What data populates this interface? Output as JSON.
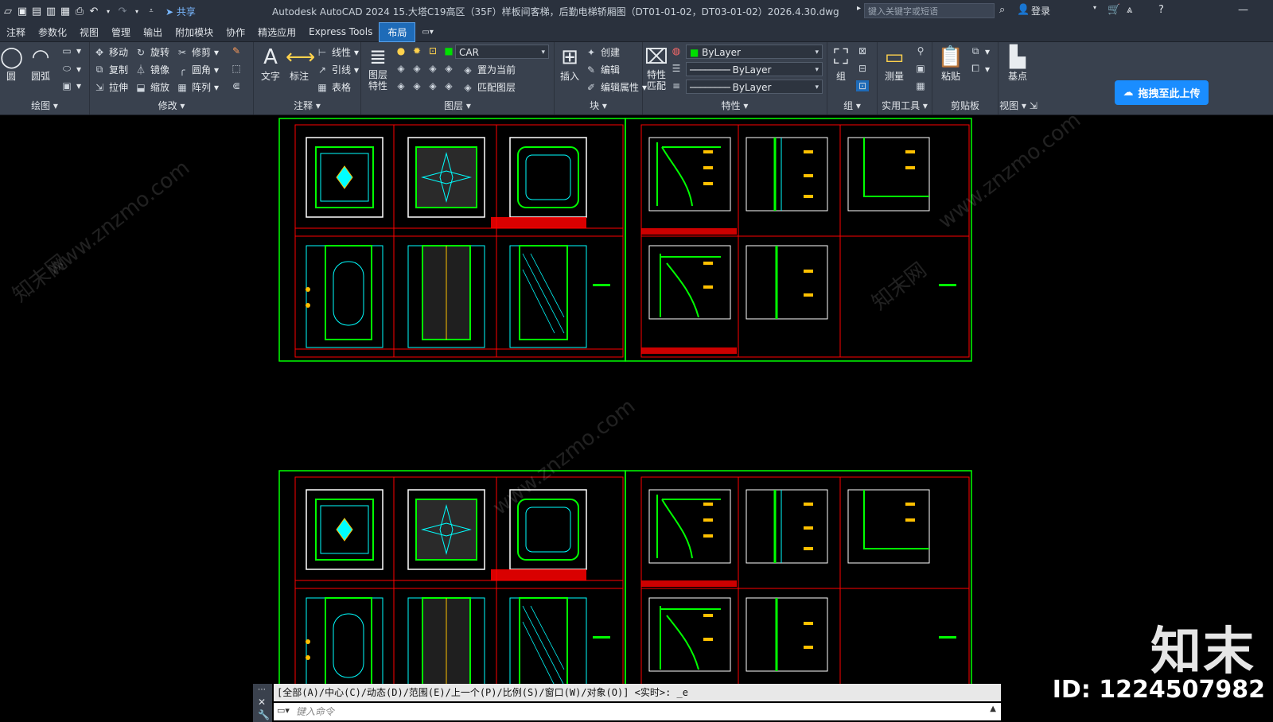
{
  "title_bar": {
    "share_label": "共享",
    "title": "Autodesk AutoCAD 2024    15.大塔C19高区（35F）样板间客梯，后勤电梯轿厢图（DT01-01-02，DT03-01-02）2026.4.30.dwg",
    "search_placeholder": "键入关键字或短语",
    "login_label": "登录"
  },
  "menu": [
    "注释",
    "参数化",
    "视图",
    "管理",
    "输出",
    "附加模块",
    "协作",
    "精选应用",
    "Express Tools",
    "布局"
  ],
  "ribbon": {
    "draw": {
      "circle": "圆",
      "arc": "圆弧",
      "label": "绘图"
    },
    "modify": {
      "move": "移动",
      "rotate": "旋转",
      "trim": "修剪",
      "copy": "复制",
      "mirror": "镜像",
      "fillet": "圆角",
      "stretch": "拉伸",
      "scale": "缩放",
      "array": "阵列",
      "label": "修改"
    },
    "annotation": {
      "text": "文字",
      "dimension": "标注",
      "linear": "线性",
      "leader": "引线",
      "table": "表格",
      "label": "注释"
    },
    "layers": {
      "layer_props": "图层特性",
      "layer_name": "CAR",
      "set_current": "置为当前",
      "match_layer": "匹配图层",
      "label": "图层"
    },
    "block": {
      "insert": "插入",
      "create": "创建",
      "edit": "编辑",
      "edit_attr": "编辑属性",
      "label": "块"
    },
    "properties": {
      "match": "特性匹配",
      "color": "ByLayer",
      "linetype": "ByLayer",
      "lineweight": "ByLayer",
      "label": "特性"
    },
    "group": {
      "group": "组",
      "label": "组"
    },
    "utilities": {
      "measure": "测量",
      "label": "实用工具"
    },
    "clipboard": {
      "paste": "粘贴",
      "label": "剪贴板"
    },
    "view": {
      "base": "基点",
      "label": "视图"
    }
  },
  "upload_button": "拖拽至此上传",
  "command": {
    "history": "[全部(A)/中心(C)/动态(D)/范围(E)/上一个(P)/比例(S)/窗口(W)/对象(O)] <实时>: _e",
    "placeholder": "键入命令"
  },
  "watermark": {
    "brand": "知末",
    "id": "ID: 1224507982",
    "site": "www.znzmo.com",
    "cn": "知末网"
  },
  "colors": {
    "accent": "#1e6bb8",
    "sheet_border": "#00ff00",
    "frame": "#ff0000",
    "cyan": "#00ffff",
    "yellow": "#ffc000"
  }
}
